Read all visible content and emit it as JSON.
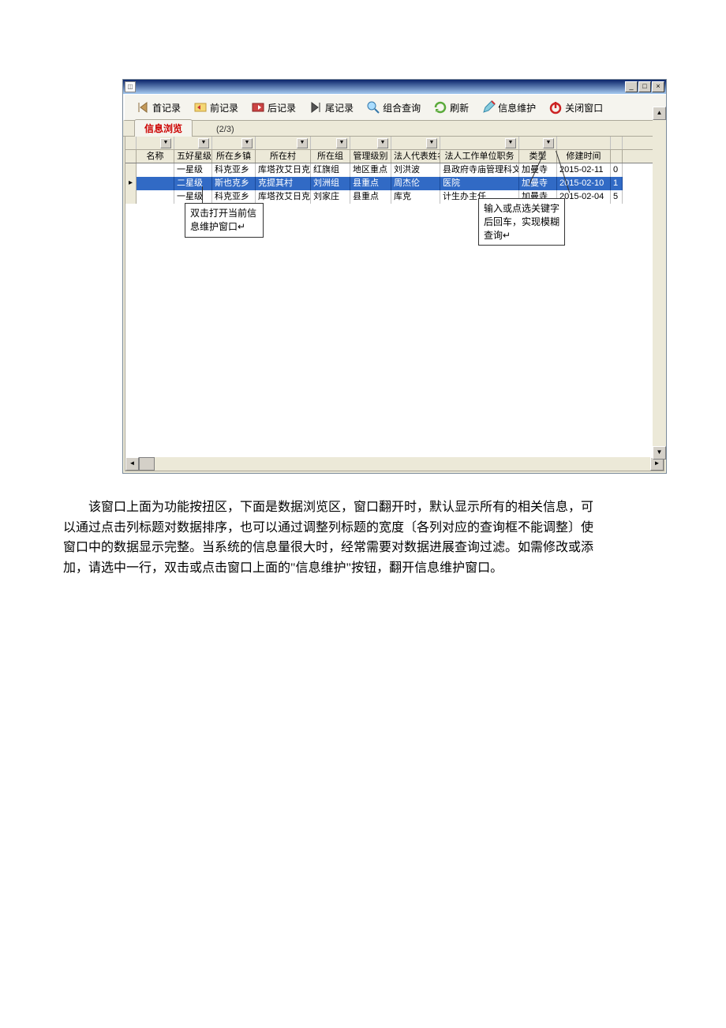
{
  "toolbar": {
    "first": "首记录",
    "prev": "前记录",
    "next": "后记录",
    "last": "尾记录",
    "query": "组合查询",
    "refresh": "刷新",
    "maintain": "信息维护",
    "close": "关闭窗口"
  },
  "tab": {
    "label": "信息浏览",
    "count": "(2/3)"
  },
  "columns": [
    "",
    "名称",
    "五好星级",
    "所在乡镇",
    "所在村",
    "所在组",
    "管理级别",
    "法人代表姓名",
    "法人工作单位职务",
    "类型",
    "修建时间",
    ""
  ],
  "rows": [
    {
      "cells": [
        "",
        "",
        "一星级",
        "科克亚乡",
        "库塔孜艾日克",
        "红旗组",
        "地区重点",
        "刘洪波",
        "县政府寺庙管理科文",
        "加曼寺",
        "2015-02-11",
        "0"
      ]
    },
    {
      "cells": [
        "▸",
        "",
        "二星级",
        "斯也克乡",
        "克提其村",
        "刘洲组",
        "县重点",
        "周杰伦",
        "医院",
        "加曼寺",
        "2015-02-10",
        "1"
      ],
      "selected": true
    },
    {
      "cells": [
        "",
        "",
        "一星级",
        "科克亚乡",
        "库塔孜艾日克",
        "刘家庄",
        "县重点",
        "库克",
        "计生办主任",
        "加曼寺",
        "2015-02-04",
        "5"
      ]
    }
  ],
  "callout1": "双击打开当前信息维护窗口↵",
  "callout2": "输入或点选关键字后回车，实现模糊查询↵",
  "description": "该窗口上面为功能按扭区，下面是数据浏览区，窗口翻开时，默认显示所有的相关信息，可以通过点击列标题对数据排序，也可以通过调整列标题的宽度〔各列对应的查询框不能调整〕使窗口中的数据显示完整。当系统的信息量很大时，经常需要对数据进展查询过滤。如需修改或添加，请选中一行，双击或点击窗口上面的\"信息维护\"按钮，翻开信息维护窗口。"
}
